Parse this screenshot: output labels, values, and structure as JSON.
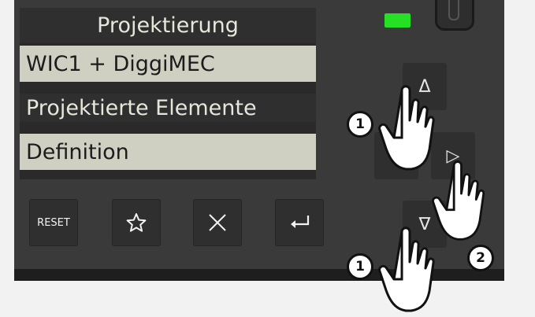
{
  "display": {
    "title": "Projektierung",
    "items": [
      {
        "label": "WIC1 + DiggiMEC"
      },
      {
        "label": "Projektierte Elemente"
      },
      {
        "label": "Definition"
      }
    ]
  },
  "keys": {
    "reset": "RESET",
    "favorite_icon": "star-icon",
    "cancel_icon": "close-icon",
    "enter_icon": "enter-icon"
  },
  "navigation": {
    "up": "Δ",
    "right": "▷",
    "down": "∇"
  },
  "callouts": {
    "step1": "1",
    "step2": "2"
  },
  "colors": {
    "led": "#25e025",
    "highlight_row": "#cfcfc2",
    "panel": "#3a3a3a"
  }
}
